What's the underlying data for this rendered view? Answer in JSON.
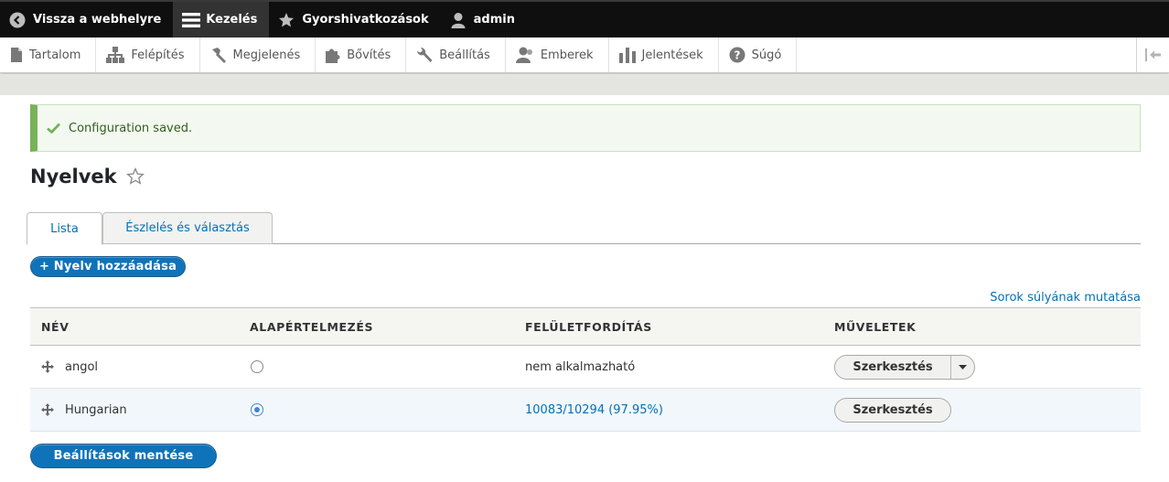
{
  "toolbar": {
    "back_label": "Vissza a webhelyre",
    "manage_label": "Kezelés",
    "shortcuts_label": "Gyorshivatkozások",
    "user_label": "admin"
  },
  "tray": {
    "items": [
      {
        "label": "Tartalom",
        "icon": "file-icon"
      },
      {
        "label": "Felépítés",
        "icon": "structure-icon"
      },
      {
        "label": "Megjelenés",
        "icon": "paintbrush-icon"
      },
      {
        "label": "Bővítés",
        "icon": "puzzle-icon"
      },
      {
        "label": "Beállítás",
        "icon": "wrench-icon"
      },
      {
        "label": "Emberek",
        "icon": "people-icon"
      },
      {
        "label": "Jelentések",
        "icon": "bar-chart-icon"
      },
      {
        "label": "Súgó",
        "icon": "help-icon"
      }
    ]
  },
  "message": {
    "text": "Configuration saved."
  },
  "page": {
    "title": "Nyelvek"
  },
  "tabs": [
    {
      "label": "Lista",
      "active": true
    },
    {
      "label": "Észlelés és választás",
      "active": false
    }
  ],
  "actions": {
    "add_language": "+ Nyelv hozzáadása",
    "show_row_weights": "Sorok súlyának mutatása",
    "save": "Beállítások mentése"
  },
  "table": {
    "headers": [
      "NÉV",
      "ALAPÉRTELMEZÉS",
      "FELÜLETFORDÍTÁS",
      "MŰVELETEK"
    ],
    "rows": [
      {
        "name": "angol",
        "default": false,
        "translation": "nem alkalmazható",
        "translation_is_link": false,
        "op": "Szerkesztés",
        "has_dropdown": true
      },
      {
        "name": "Hungarian",
        "default": true,
        "translation": "10083/10294 (97.95%)",
        "translation_is_link": true,
        "op": "Szerkesztés",
        "has_dropdown": false
      }
    ]
  },
  "colors": {
    "toolbar_bg": "#0f0f0f",
    "accent": "#0f73b9",
    "link": "#0071b8",
    "success": "#77b259"
  }
}
